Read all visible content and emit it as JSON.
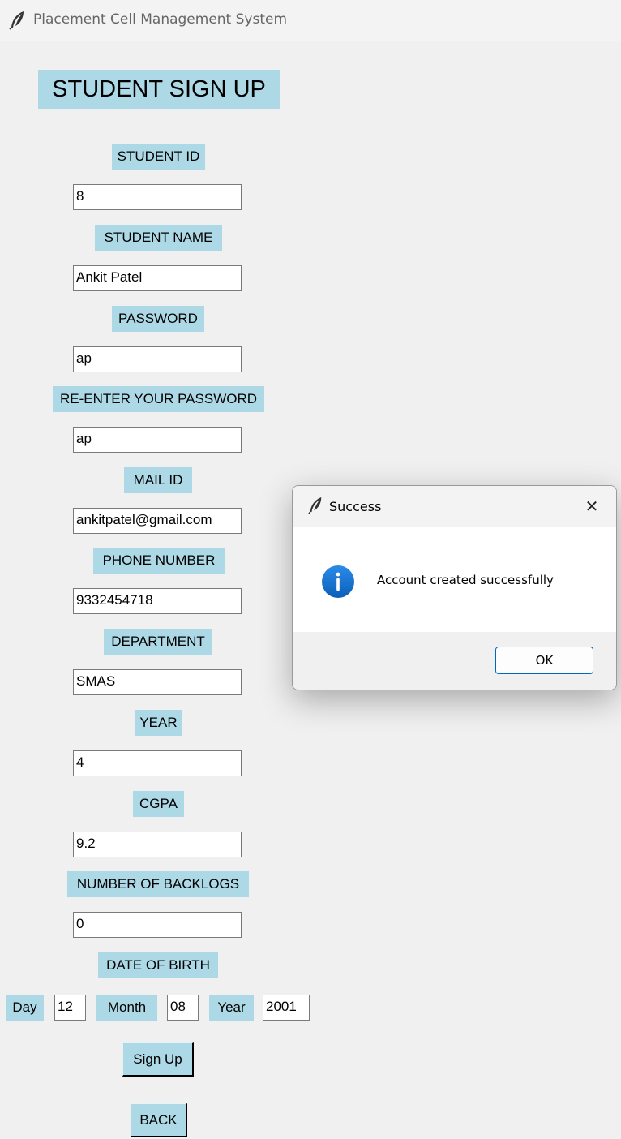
{
  "window": {
    "title": "Placement Cell Management System"
  },
  "form": {
    "heading": "STUDENT SIGN UP",
    "fields": {
      "student_id": {
        "label": "STUDENT ID",
        "value": "8"
      },
      "student_name": {
        "label": "STUDENT NAME",
        "value": "Ankit Patel"
      },
      "password": {
        "label": "PASSWORD",
        "value": "ap"
      },
      "reenter_password": {
        "label": "RE-ENTER YOUR PASSWORD",
        "value": "ap"
      },
      "mail_id": {
        "label": "MAIL ID",
        "value": "ankitpatel@gmail.com"
      },
      "phone_number": {
        "label": "PHONE NUMBER",
        "value": "9332454718"
      },
      "department": {
        "label": "DEPARTMENT",
        "value": "SMAS"
      },
      "year": {
        "label": "YEAR",
        "value": "4"
      },
      "cgpa": {
        "label": "CGPA",
        "value": "9.2"
      },
      "backlogs": {
        "label": "NUMBER OF BACKLOGS",
        "value": "0"
      }
    },
    "dob": {
      "label": "DATE OF BIRTH",
      "day_label": "Day",
      "day_value": "12",
      "month_label": "Month",
      "month_value": "08",
      "year_label": "Year",
      "year_value": "2001"
    },
    "signup_label": "Sign Up",
    "back_label": "BACK"
  },
  "dialog": {
    "title": "Success",
    "message": "Account created successfully",
    "ok_label": "OK",
    "close_glyph": "✕"
  },
  "colors": {
    "label_bg": "#add8e6",
    "window_bg": "#f0f0f0",
    "info_blue": "#0a6fcf",
    "ok_border": "#0067c0"
  }
}
